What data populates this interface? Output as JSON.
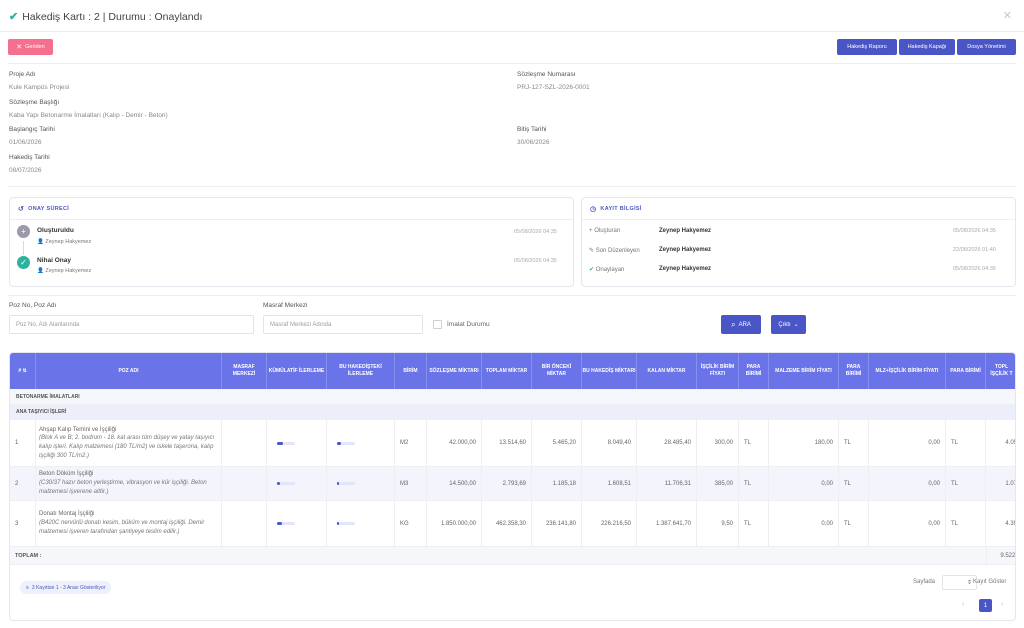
{
  "header": {
    "title": "Hakediş Kartı : 2 | Durumu : Onaylandı"
  },
  "toolbar": {
    "back_label": "Geriden",
    "report_label": "Hakediş Raporu",
    "cover_label": "Hakediş Kapağı",
    "files_label": "Dosya Yönetimi"
  },
  "info": {
    "project_label": "Proje Adı",
    "project": "Kule Kampüs Projesi",
    "contract_no_label": "Sözleşme Numarası",
    "contract_no": "PRJ-127-SZL-2026-0001",
    "contract_title_label": "Sözleşme Başlığı",
    "contract_title": "Kaba Yapı Betonarme İmalatları (Kalıp - Demir - Beton)",
    "start_label": "Başlangıç Tarihi",
    "start": "01/06/2026",
    "end_label": "Bitiş Tarihi",
    "end": "30/06/2026",
    "progress_date_label": "Hakediş Tarihi",
    "progress_date": "08/07/2026"
  },
  "approval": {
    "title": "ONAY SÜRECİ",
    "steps": [
      {
        "name": "Oluşturuldu",
        "user": "Zeynep Hakyemez",
        "time": "05/08/2026 04:35"
      },
      {
        "name": "Nihai Onay",
        "user": "Zeynep Hakyemez",
        "time": "05/08/2026 04:35"
      }
    ]
  },
  "record": {
    "title": "KAYIT BİLGİSİ",
    "rows": [
      {
        "label": "Oluşturan",
        "user": "Zeynep Hakyemez",
        "time": "05/08/2026 04:35"
      },
      {
        "label": "Son Düzenleyen",
        "user": "Zeynep Hakyemez",
        "time": "22/08/2026 01:40"
      },
      {
        "label": "Onaylayan",
        "user": "Zeynep Hakyemez",
        "time": "05/08/2026 04:35"
      }
    ]
  },
  "filters": {
    "poz_label": "Poz No, Poz Adı",
    "poz_placeholder": "Poz No, Adı Alanlarında",
    "cost_label": "Masraf Merkezi",
    "cost_placeholder": "Masraf Merkezi Adında",
    "imalat_label": "İmalat Durumu",
    "search_label": "ARA",
    "output_label": "Çıktı"
  },
  "table": {
    "headers": [
      "#",
      "POZ ADI",
      "MASRAF MERKEZİ",
      "KÜMÜLATİF İLERLEME",
      "BU HAKEDİŞTEKİ İLERLEME",
      "BİRİM",
      "SÖZLEŞME MİKTARI",
      "TOPLAM MİKTAR",
      "BİR ÖNCEKİ MİKTAR",
      "BU HAKEDİŞ MİKTARI",
      "KALAN MİKTAR",
      "İŞÇİLİK BİRİM FİYATI",
      "PARA BİRİMİ",
      "MALZEME BİRİM FİYATI",
      "PARA BİRİMİ",
      "MLZ+İŞÇİLİK BİRİM FİYATI",
      "PARA BİRİMİ",
      "TOPL İŞÇİLİK T"
    ],
    "group1": "BETONARME İMALATLARI",
    "group2": "ANA TAŞIYICI İŞLERİ",
    "rows": [
      {
        "no": "1",
        "name": "Ahşap Kalıp Temini ve İşçiliği",
        "desc": "(Blok A ve B; 2. bodrum - 18. kat arası tüm düşey ve yatay taşıyıcı kalıp işleri. Kalıp malzemesi (180 TL/m2) ve iskele taşerona, kalıp işçiliği 300 TL/m2.)",
        "cum": 0.32,
        "cur": 0.2,
        "unit": "M2",
        "contract": "42.000,00",
        "total": "13.514,60",
        "prev": "5.465,20",
        "this": "8.049,40",
        "remain": "28.485,40",
        "labor_price": "300,00",
        "cur1": "TL",
        "mat_price": "180,00",
        "cur2": "TL",
        "sum_price": "0,00",
        "cur3": "TL",
        "labor_total": "4.05"
      },
      {
        "no": "2",
        "name": "Beton Döküm İşçiliği",
        "desc": "(C30/37 hazır beton yerleştirme, vibrasyon ve kür işçiliği. Beton malzemesi işverene aittir.)",
        "cum": 0.19,
        "cur": 0.12,
        "unit": "M3",
        "contract": "14.500,00",
        "total": "2.793,69",
        "prev": "1.185,18",
        "this": "1.608,51",
        "remain": "11.706,31",
        "labor_price": "385,00",
        "cur1": "TL",
        "mat_price": "0,00",
        "cur2": "TL",
        "sum_price": "0,00",
        "cur3": "TL",
        "labor_total": "1.07"
      },
      {
        "no": "3",
        "name": "Donatı Montaj İşçiliği",
        "desc": "(B420C nervürlü donatı kesim, büküm ve montaj işçiliği. Demir malzemesi işveren tarafından şantiyeye teslim edilir.)",
        "cum": 0.25,
        "cur": 0.12,
        "unit": "KG",
        "contract": "1.850.000,00",
        "total": "462.358,30",
        "prev": "236.141,80",
        "this": "226.216,50",
        "remain": "1.387.641,70",
        "labor_price": "9,50",
        "cur1": "TL",
        "mat_price": "0,00",
        "cur2": "TL",
        "sum_price": "0,00",
        "cur3": "TL",
        "labor_total": "4.39"
      }
    ],
    "total_label": "TOPLAM :",
    "total_value": "9.522,"
  },
  "footer": {
    "info": "3 Kayıttan 1 - 3 Arası Gösteriliyor",
    "per_page_label": "Sayfada",
    "per_page_suffix": "Kayıt Göster",
    "page": "1"
  },
  "colors": {
    "accent": "#4a56c6",
    "header": "#6a74e8",
    "danger": "#f5708e",
    "success": "#2bb3a0"
  }
}
